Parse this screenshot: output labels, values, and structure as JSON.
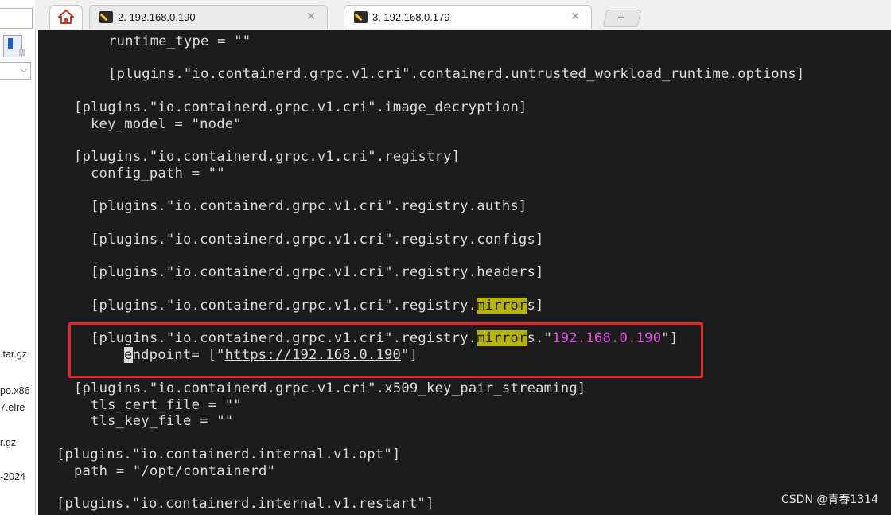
{
  "tabs": [
    {
      "label": "2. 192.168.0.190"
    },
    {
      "label": "3. 192.168.0.179"
    }
  ],
  "tab_close_symbol": "✕",
  "new_tab_symbol": "+",
  "left_panel": {
    "chevron": "⌵",
    "files": [
      ".tar.gz",
      "po.x86",
      "7.elre",
      "r.gz",
      "-2024"
    ]
  },
  "terminal": {
    "lines": [
      {
        "text": "runtime_type = \"\""
      },
      {
        "text": "[plugins.\"io.containerd.grpc.v1.cri\".containerd.untrusted_workload_runtime.options]"
      },
      {
        "text": "[plugins.\"io.containerd.grpc.v1.cri\".image_decryption]"
      },
      {
        "text": "key_model = \"node\""
      },
      {
        "text": "[plugins.\"io.containerd.grpc.v1.cri\".registry]"
      },
      {
        "text": "config_path = \"\""
      },
      {
        "text": "[plugins.\"io.containerd.grpc.v1.cri\".registry.auths]"
      },
      {
        "text": "[plugins.\"io.containerd.grpc.v1.cri\".registry.configs]"
      },
      {
        "text": "[plugins.\"io.containerd.grpc.v1.cri\".registry.headers]"
      },
      {
        "prefix": "[plugins.\"io.containerd.grpc.v1.cri\".registry.",
        "highlight": "mirror",
        "suffix": "s]"
      },
      {
        "prefix": "[plugins.\"io.containerd.grpc.v1.cri\".registry.",
        "highlight": "mirror",
        "mid": "s.\"",
        "ip": "192.168.0.190",
        "suffix": "\"]"
      },
      {
        "cursor": "e",
        "prefix": "ndpoint= [\"",
        "url": "https://192.168.0.190",
        "suffix": "\"]"
      },
      {
        "text": "[plugins.\"io.containerd.grpc.v1.cri\".x509_key_pair_streaming]"
      },
      {
        "text": "tls_cert_file = \"\""
      },
      {
        "text": "tls_key_file = \"\""
      },
      {
        "text": "[plugins.\"io.containerd.internal.v1.opt\"]"
      },
      {
        "text": "path = \"/opt/containerd\""
      },
      {
        "text": "[plugins.\"io.containerd.internal.v1.restart\"]"
      }
    ]
  },
  "watermark": "CSDN @青春1314",
  "colors": {
    "terminal_bg": "#1c1c1c",
    "search_highlight": "#b6b300",
    "string_magenta": "#e64ee6",
    "annotation_red": "#e02a2a"
  }
}
